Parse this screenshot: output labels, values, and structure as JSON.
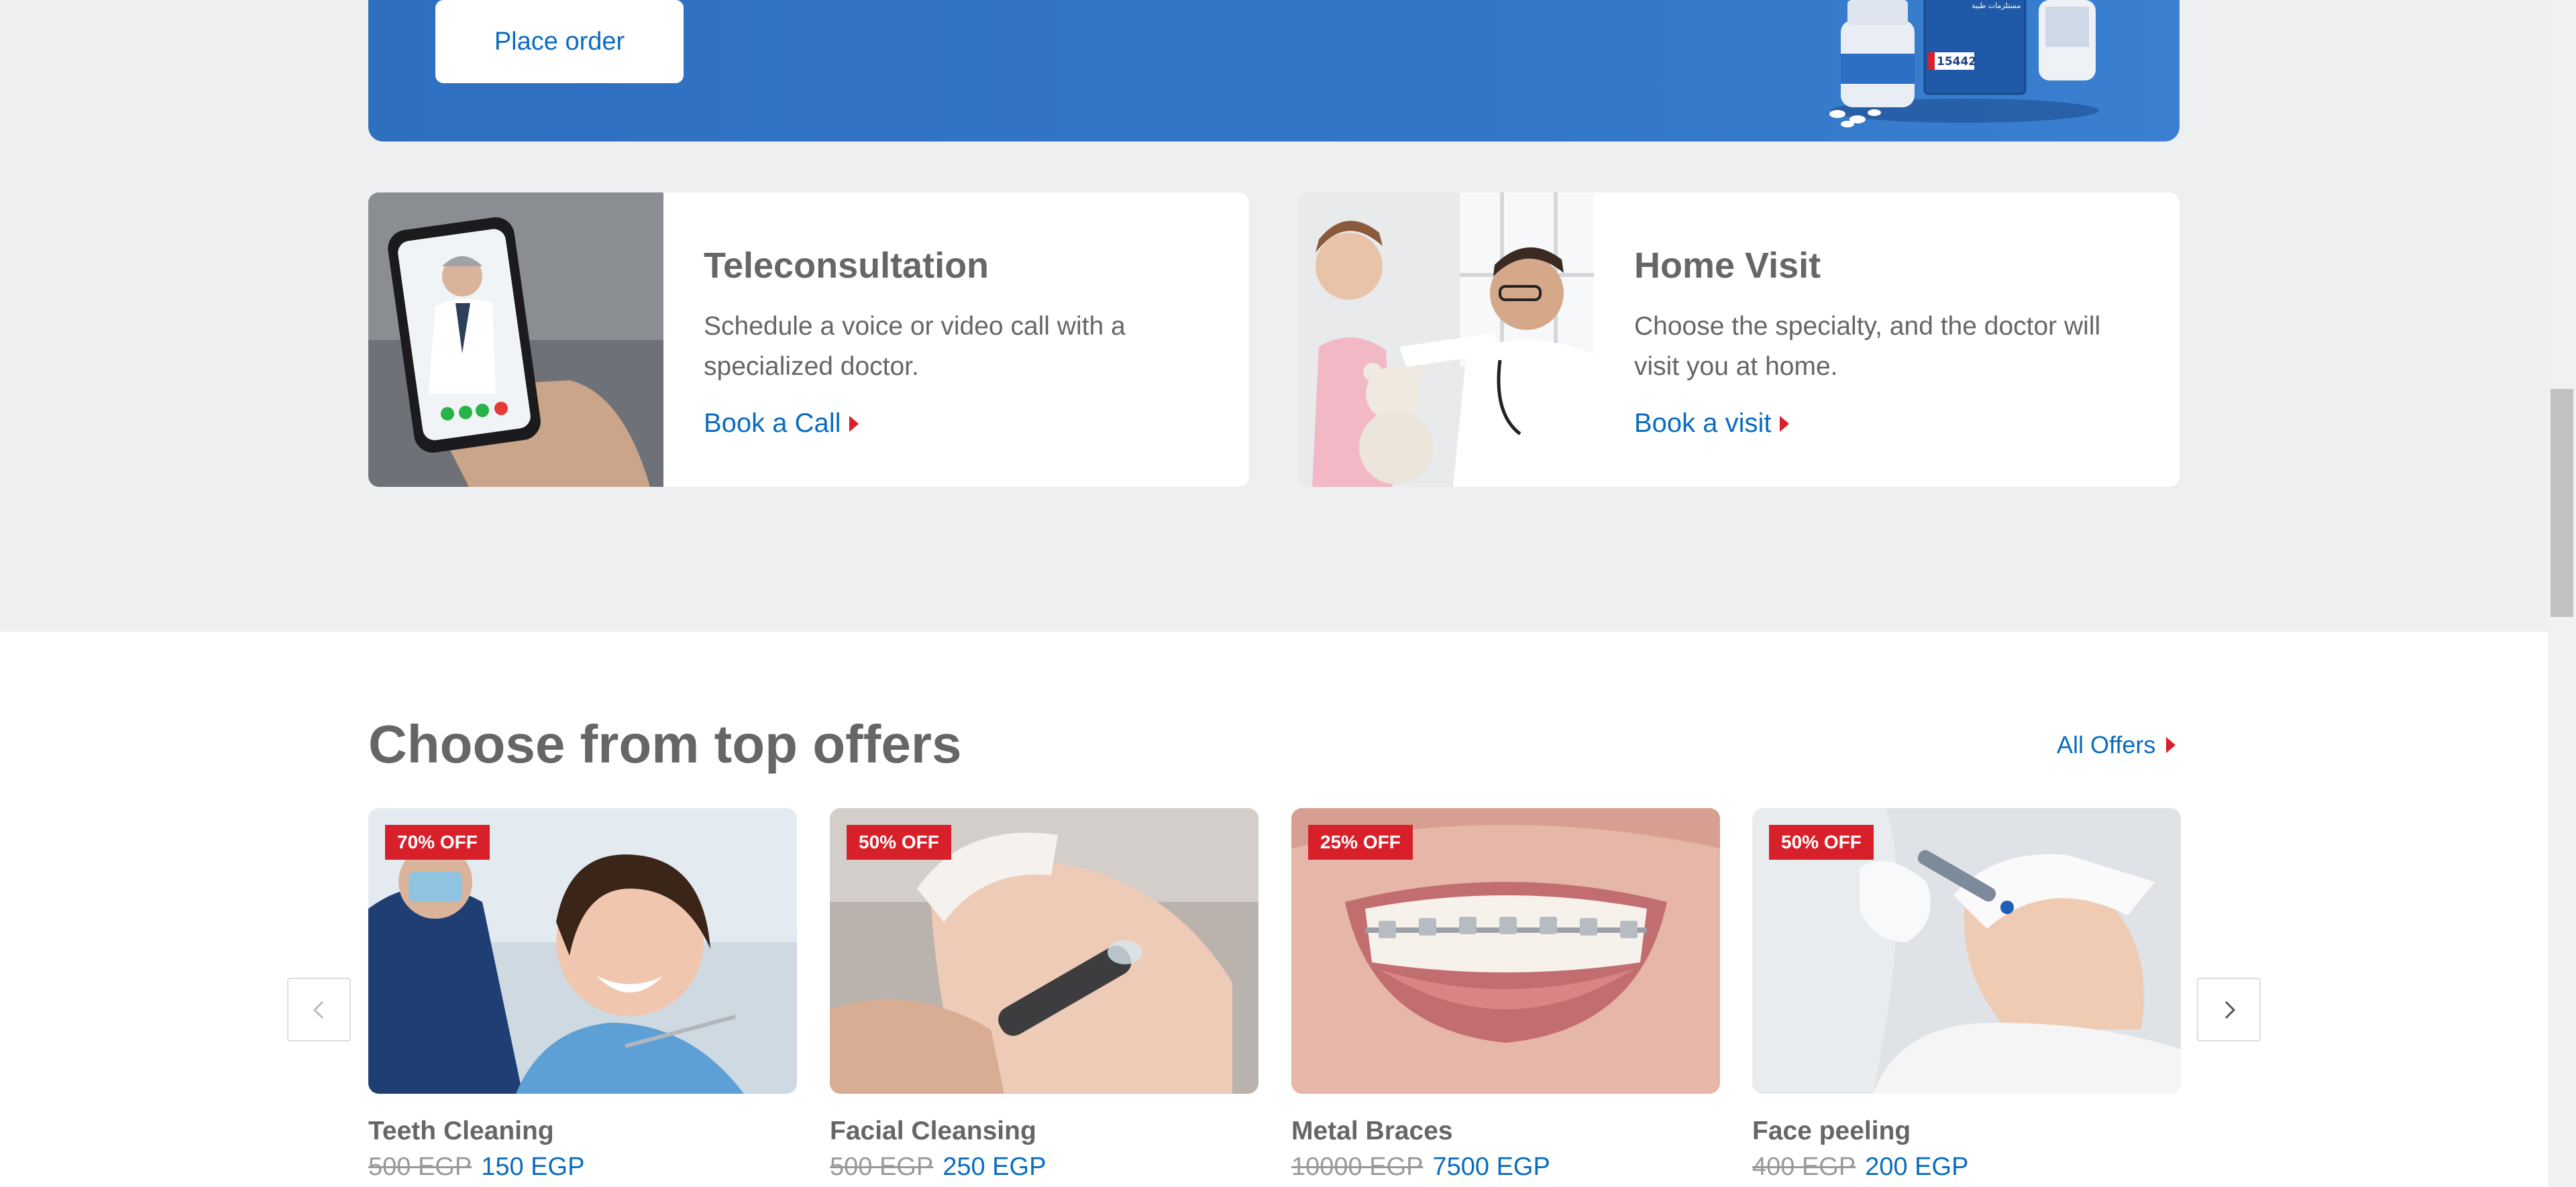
{
  "banner": {
    "place_order_label": "Place order",
    "badge_number": "15442"
  },
  "services": [
    {
      "title": "Teleconsultation",
      "description": "Schedule a voice or video call with a specialized doctor.",
      "link_label": "Book a Call"
    },
    {
      "title": "Home Visit",
      "description": "Choose the specialty, and the doctor will visit you at home.",
      "link_label": "Book a visit"
    }
  ],
  "offers": {
    "title": "Choose from top offers",
    "all_offers_label": "All Offers",
    "items": [
      {
        "badge": "70% OFF",
        "name": "Teeth Cleaning",
        "old_price": "500 EGP",
        "new_price": "150 EGP"
      },
      {
        "badge": "50% OFF",
        "name": "Facial Cleansing",
        "old_price": "500 EGP",
        "new_price": "250 EGP"
      },
      {
        "badge": "25% OFF",
        "name": "Metal Braces",
        "old_price": "10000 EGP",
        "new_price": "7500 EGP"
      },
      {
        "badge": "50% OFF",
        "name": "Face peeling",
        "old_price": "400 EGP",
        "new_price": "200 EGP"
      }
    ]
  },
  "colors": {
    "brand_blue": "#0a6cbf",
    "accent_red": "#d8202a",
    "banner_blue": "#3376c8"
  },
  "icons": {
    "prev": "chevron-left-icon",
    "next": "chevron-right-icon",
    "link_arrow": "caret-right-icon"
  }
}
